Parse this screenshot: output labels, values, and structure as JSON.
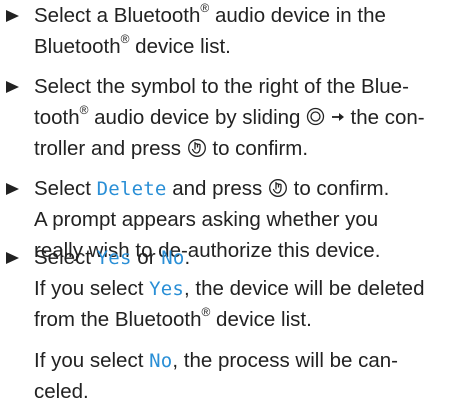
{
  "steps": [
    {
      "lines": [
        [
          "Select a Bluetooth",
          "®",
          " audio device in the"
        ],
        [
          "Bluetooth",
          "®",
          " device list."
        ]
      ]
    },
    {
      "lines": [
        [
          "Select the symbol to the right of the Blue-"
        ],
        [
          "tooth",
          "®",
          " audio device by sliding ",
          "",
          " the con-"
        ],
        [
          "troller and press ",
          "",
          " to confirm."
        ]
      ]
    },
    {
      "line1": [
        "Select ",
        "Delete",
        " and press ",
        "",
        " to confirm."
      ],
      "line2": "A prompt appears asking whether you",
      "line3": "really wish to de-authorize this device."
    },
    {
      "line1": [
        "Select ",
        "Yes",
        " or ",
        "No",
        "."
      ],
      "line2": [
        "If you select ",
        "Yes",
        ", the device will be deleted"
      ],
      "line3": [
        "from the Bluetooth",
        "®",
        " device list."
      ],
      "line4": [
        "If you select ",
        "No",
        ", the process will be can-"
      ],
      "line5": "celed."
    }
  ],
  "icons": {
    "controller": "controller-slide-icon",
    "right_arrow": "right-arrow-icon",
    "press": "press-controller-icon"
  }
}
